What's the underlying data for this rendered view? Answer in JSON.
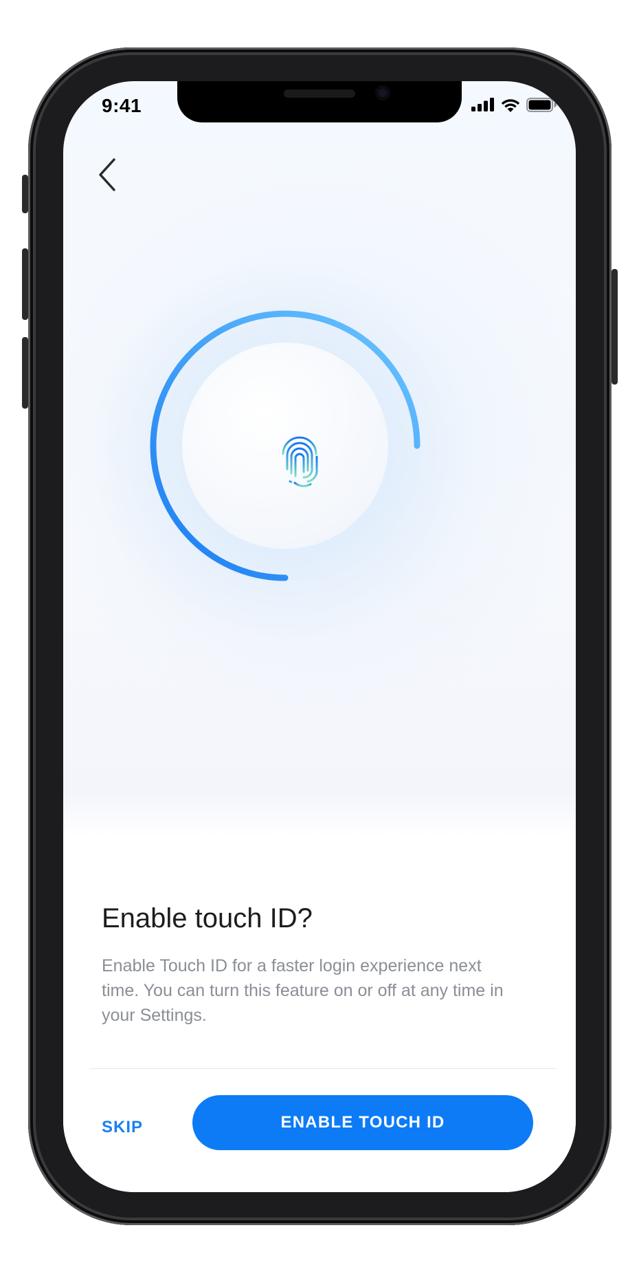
{
  "status_bar": {
    "time": "9:41",
    "icons": [
      "cellular-signal-icon",
      "wifi-icon",
      "battery-icon"
    ]
  },
  "nav": {
    "back_icon": "chevron-left-icon"
  },
  "hero": {
    "icon": "fingerprint-icon",
    "progress_fraction": 0.75,
    "colors": {
      "arc_start": "#1a7cf2",
      "arc_end": "#6cc6ff",
      "fingerprint_top": "#1877f2",
      "fingerprint_bottom": "#7ee0c8"
    }
  },
  "dialog": {
    "title": "Enable touch ID?",
    "description": "Enable Touch ID for a faster login experience next time. You can turn this feature on or off at any time in your Settings.",
    "skip_label": "SKIP",
    "enable_label": "ENABLE TOUCH ID"
  },
  "colors": {
    "accent": "#0d7bf5",
    "title_text": "#1d1d1f",
    "body_text": "#8a8e96"
  }
}
